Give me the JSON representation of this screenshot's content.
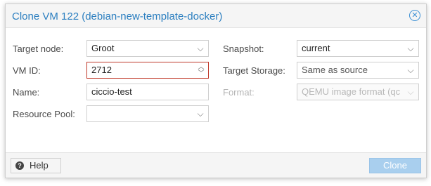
{
  "dialog": {
    "title": "Clone VM 122 (debian-new-template-docker)",
    "close_icon": "close-icon"
  },
  "form": {
    "target_node": {
      "label": "Target node:",
      "value": "Groot"
    },
    "vm_id": {
      "label": "VM ID:",
      "value": "2712"
    },
    "name": {
      "label": "Name:",
      "value": "ciccio-test"
    },
    "resource_pool": {
      "label": "Resource Pool:",
      "value": ""
    },
    "snapshot": {
      "label": "Snapshot:",
      "value": "current"
    },
    "target_storage": {
      "label": "Target Storage:",
      "value": "Same as source"
    },
    "format": {
      "label": "Format:",
      "value": "QEMU image format (qc"
    }
  },
  "footer": {
    "help_label": "Help",
    "help_icon": "question-circle-icon",
    "clone_label": "Clone"
  },
  "colors": {
    "title": "#2c7fc0",
    "invalid_border": "#c0392b",
    "clone_disabled_bg": "#a9cfee"
  }
}
